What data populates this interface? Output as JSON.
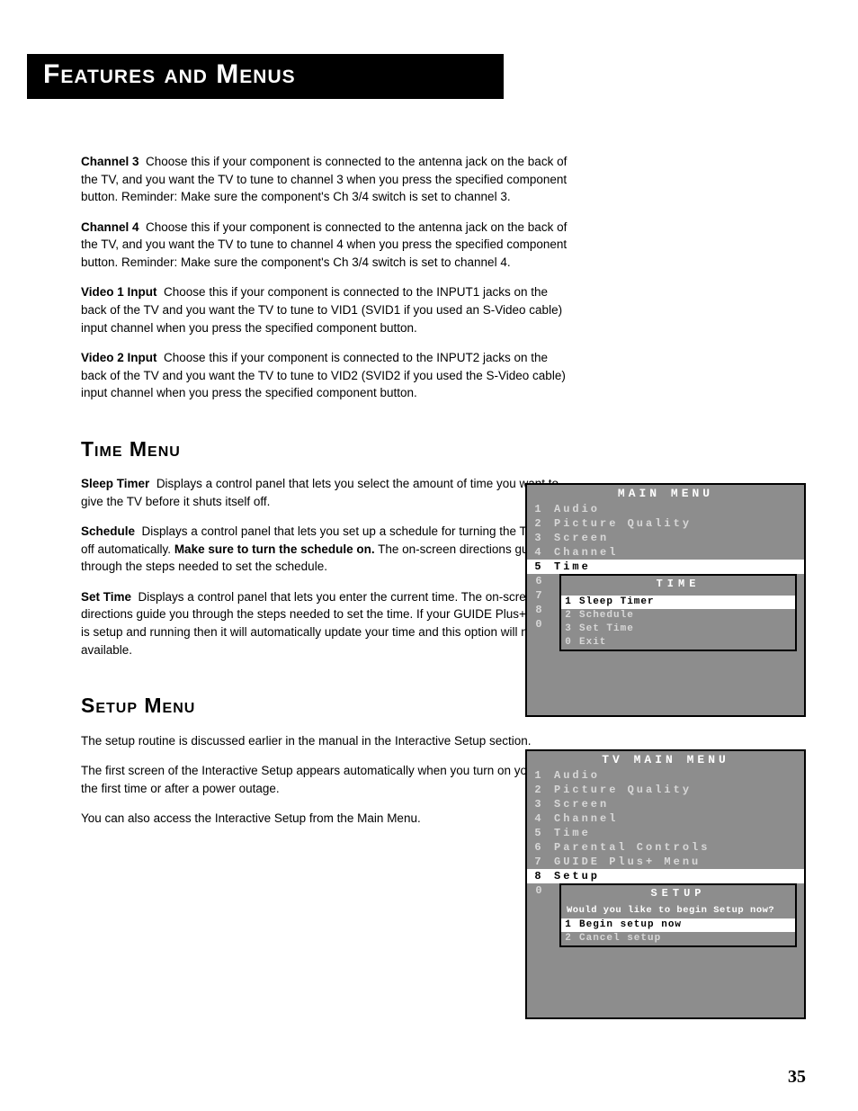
{
  "page": {
    "title": "Features and Menus",
    "number": "35"
  },
  "entries": {
    "ch3": {
      "lead": "Channel 3",
      "text": "Choose this if your component is connected to the antenna jack on the back of the TV, and you want the TV to tune to channel 3 when you press the specified component button. Reminder: Make sure the component's Ch 3/4 switch is set to channel 3."
    },
    "ch4": {
      "lead": "Channel 4",
      "text": "Choose this if your component is connected to the antenna jack on the back of the TV, and you want the TV to tune to channel 4 when you press the specified component button. Reminder: Make sure the component's Ch 3/4 switch is set to channel 4."
    },
    "vid1": {
      "lead": "Video 1 Input",
      "text": "Choose this if your component is connected to the INPUT1 jacks on the back of the TV and you want the TV to tune to VID1 (SVID1 if you used an S-Video cable) input channel when you press the specified component button."
    },
    "vid2": {
      "lead": "Video 2 Input",
      "text": "Choose this if your component is connected to the INPUT2 jacks on the back of the TV and you want the TV to tune to VID2 (SVID2 if you used the S-Video cable) input channel when you press the specified component button."
    }
  },
  "time_section": {
    "heading": "Time Menu",
    "sleep": {
      "lead": "Sleep Timer",
      "text": "Displays a control panel that lets you select the amount of time you want to give the TV before it shuts itself off."
    },
    "schedule": {
      "lead": "Schedule",
      "text_a": "Displays a control panel that lets you set up a schedule for turning the TV on and off automatically. ",
      "bold": "Make sure to turn the schedule on.",
      "text_b": " The on-screen directions guide you through the steps needed to set the schedule."
    },
    "settime": {
      "lead": "Set Time",
      "text": "Displays a control panel that lets you enter the current time. The on-screen directions guide you through the steps needed to set the time. If your GUIDE Plus+ system is setup and running then it will automatically update your time and this option will not be available."
    }
  },
  "setup_section": {
    "heading": "Setup Menu",
    "p1": "The setup routine is discussed earlier in the manual in the Interactive Setup section.",
    "p2": "The first screen of the Interactive Setup appears automatically when you turn on your TV for the first time or after a power outage.",
    "p3": "You can also access the Interactive Setup from the Main Menu."
  },
  "osd_time": {
    "title": "MAIN MENU",
    "items": [
      {
        "n": "1",
        "label": "Audio"
      },
      {
        "n": "2",
        "label": "Picture Quality"
      },
      {
        "n": "3",
        "label": "Screen"
      },
      {
        "n": "4",
        "label": "Channel"
      },
      {
        "n": "5",
        "label": "Time"
      }
    ],
    "side_tail": [
      "6",
      "7",
      "8",
      "0"
    ],
    "panel_title": "TIME",
    "panel_items": [
      {
        "n": "1",
        "label": "Sleep Timer",
        "sel": true
      },
      {
        "n": "2",
        "label": "Schedule"
      },
      {
        "n": "3",
        "label": "Set Time"
      },
      {
        "n": "0",
        "label": "Exit"
      }
    ]
  },
  "osd_setup": {
    "title": "TV MAIN MENU",
    "items": [
      {
        "n": "1",
        "label": "Audio"
      },
      {
        "n": "2",
        "label": "Picture Quality"
      },
      {
        "n": "3",
        "label": "Screen"
      },
      {
        "n": "4",
        "label": "Channel"
      },
      {
        "n": "5",
        "label": "Time"
      },
      {
        "n": "6",
        "label": "Parental Controls"
      },
      {
        "n": "7",
        "label": "GUIDE Plus+ Menu"
      },
      {
        "n": "8",
        "label": "Setup"
      }
    ],
    "side_tail": [
      "0"
    ],
    "panel_title": "SETUP",
    "prompt": "Would you like to begin Setup now?",
    "panel_items": [
      {
        "n": "1",
        "label": "Begin setup now",
        "sel": true
      },
      {
        "n": "2",
        "label": "Cancel setup"
      }
    ]
  }
}
